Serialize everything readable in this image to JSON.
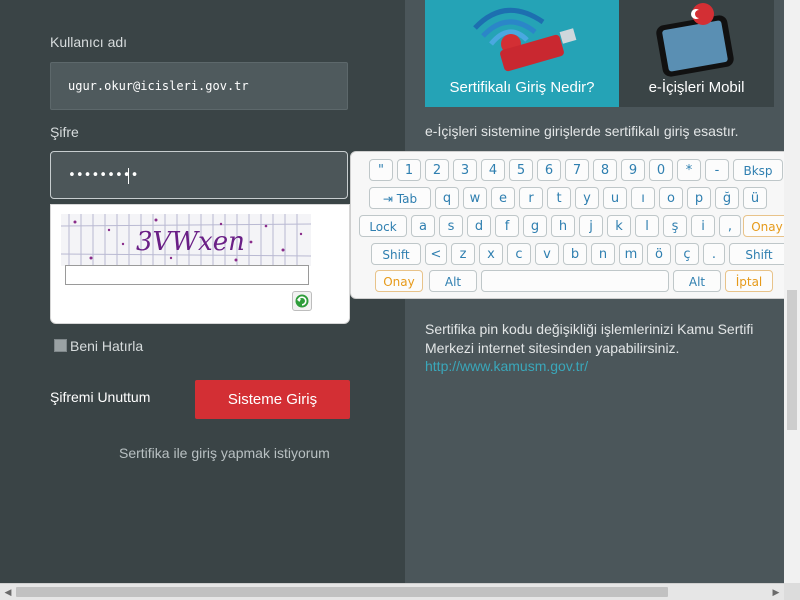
{
  "login": {
    "username_label": "Kullanıcı adı",
    "username_value": "ugur.okur@icisleri.gov.tr",
    "password_label": "Şifre",
    "password_value": "•••••••••",
    "captcha_text": "3VWxen",
    "remember_label": "Beni Hatırla",
    "forgot_label": "Şifremi Unuttum",
    "login_button": "Sisteme Giriş",
    "certificate_link": "Sertifika ile giriş yapmak istiyorum"
  },
  "tiles": [
    {
      "label": "Sertifikalı Giriş Nedir?"
    },
    {
      "label": "e-İçişleri Mobil"
    }
  ],
  "right": {
    "text1": "e-İçişleri sistemine girişlerde sertifikalı giriş esastır.",
    "text2a": "Sertifika pin kodu değişikliği işlemlerinizi Kamu Sertifi",
    "text2b": "Merkezi internet sitesinden yapabilirsiniz.",
    "link": "http://www.kamusm.gov.tr/"
  },
  "keyboard": {
    "rows": [
      [
        "\"",
        "1",
        "2",
        "3",
        "4",
        "5",
        "6",
        "7",
        "8",
        "9",
        "0",
        "*",
        "-",
        "Bksp"
      ],
      [
        "⇥ Tab",
        "q",
        "w",
        "e",
        "r",
        "t",
        "y",
        "u",
        "ı",
        "o",
        "p",
        "ğ",
        "ü"
      ],
      [
        "Lock",
        "a",
        "s",
        "d",
        "f",
        "g",
        "h",
        "j",
        "k",
        "l",
        "ş",
        "i",
        ",",
        "Onay"
      ],
      [
        "Shift",
        "<",
        "z",
        "x",
        "c",
        "v",
        "b",
        "n",
        "m",
        "ö",
        "ç",
        ".",
        "Shift"
      ],
      [
        "Onay",
        "Alt",
        "",
        "Alt",
        "İptal"
      ]
    ]
  }
}
